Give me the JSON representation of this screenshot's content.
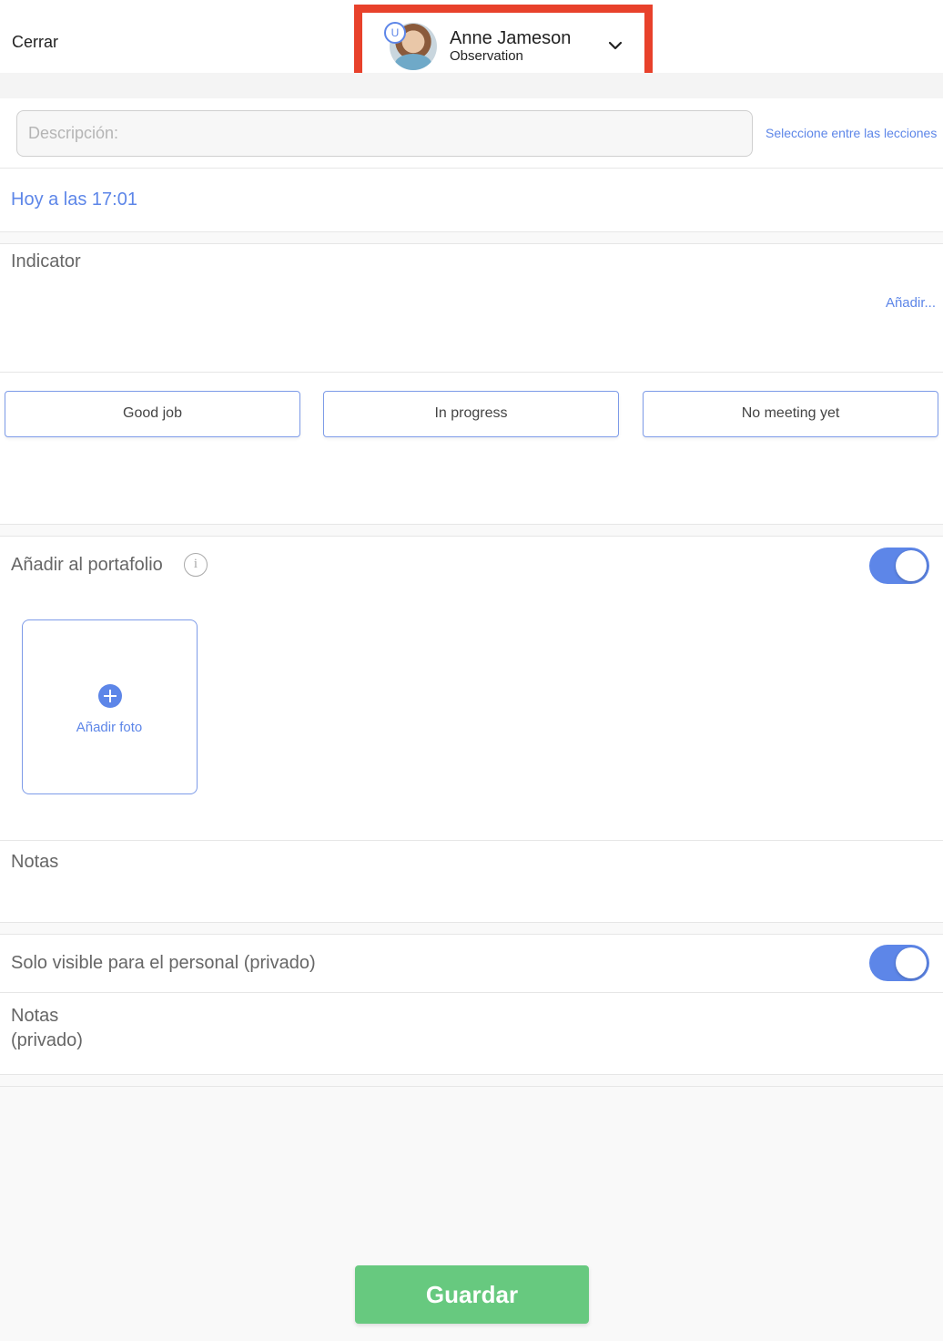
{
  "header": {
    "close_label": "Cerrar",
    "student": {
      "badge": "U",
      "name": "Anne Jameson",
      "subtitle": "Observation"
    }
  },
  "description": {
    "placeholder": "Descripción:",
    "value": "",
    "lessons_link": "Seleccione entre las lecciones"
  },
  "date": {
    "label": "Hoy a las 17:01"
  },
  "indicator": {
    "label": "Indicator",
    "add_link": "Añadir..."
  },
  "options": [
    {
      "label": "Good job"
    },
    {
      "label": "In progress"
    },
    {
      "label": "No meeting yet"
    }
  ],
  "portfolio": {
    "label": "Añadir al portafolio",
    "info_glyph": "i",
    "toggle_on": true,
    "add_photo_label": "Añadir foto"
  },
  "notes": {
    "label": "Notas"
  },
  "private": {
    "label": "Solo visible para el personal (privado)",
    "toggle_on": true,
    "notes_label_line1": "Notas",
    "notes_label_line2": "(privado)"
  },
  "save_label": "Guardar",
  "colors": {
    "accent": "#5d86e8",
    "highlight_border": "#e8412b",
    "save_green": "#67c97f"
  }
}
